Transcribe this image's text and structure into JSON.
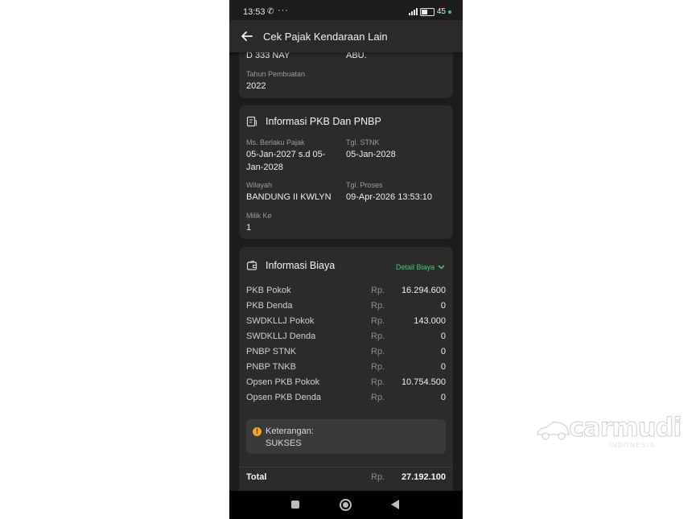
{
  "status_bar": {
    "time": "13:53",
    "battery": "45"
  },
  "app_bar": {
    "title": "Cek Pajak Kendaraan Lain"
  },
  "vehicle_card": {
    "plate": "D 333 NAY",
    "color": "ABU.",
    "year_label": "Tahun Pembuatan",
    "year_value": "2022"
  },
  "pkb_card": {
    "title": "Informasi PKB Dan PNBP",
    "tax_period_label": "Ms. Berlaku Pajak",
    "tax_period_line1": "05-Jan-2027 s.d 05-",
    "tax_period_line2": "Jan-2028",
    "stnk_label": "Tgl. STNK",
    "stnk_value": "05-Jan-2028",
    "region_label": "Wilayah",
    "region_value": "BANDUNG II KWLYN",
    "process_label": "Tgl. Proses",
    "process_value": "09-Apr-2026 13:53:10",
    "owner_label": "Milik Ke",
    "owner_value": "1"
  },
  "fee_card": {
    "title": "Informasi Biaya",
    "detail_link": "Detail Biaya",
    "currency": "Rp.",
    "rows": [
      {
        "name": "PKB Pokok",
        "amount": "16.294.600"
      },
      {
        "name": "PKB Denda",
        "amount": "0"
      },
      {
        "name": "SWDKLLJ Pokok",
        "amount": "143.000"
      },
      {
        "name": "SWDKLLJ Denda",
        "amount": "0"
      },
      {
        "name": "PNBP STNK",
        "amount": "0"
      },
      {
        "name": "PNBP TNKB",
        "amount": "0"
      },
      {
        "name": "Opsen PKB Pokok",
        "amount": "10.754.500"
      },
      {
        "name": "Opsen PKB Denda",
        "amount": "0"
      }
    ],
    "note_label": "Keterangan:",
    "note_value": "SUKSES"
  },
  "total": {
    "label": "Total",
    "currency": "Rp.",
    "value": "27.192.100"
  },
  "watermark": {
    "brand": "carmudi",
    "sub": "INDONESIA"
  }
}
